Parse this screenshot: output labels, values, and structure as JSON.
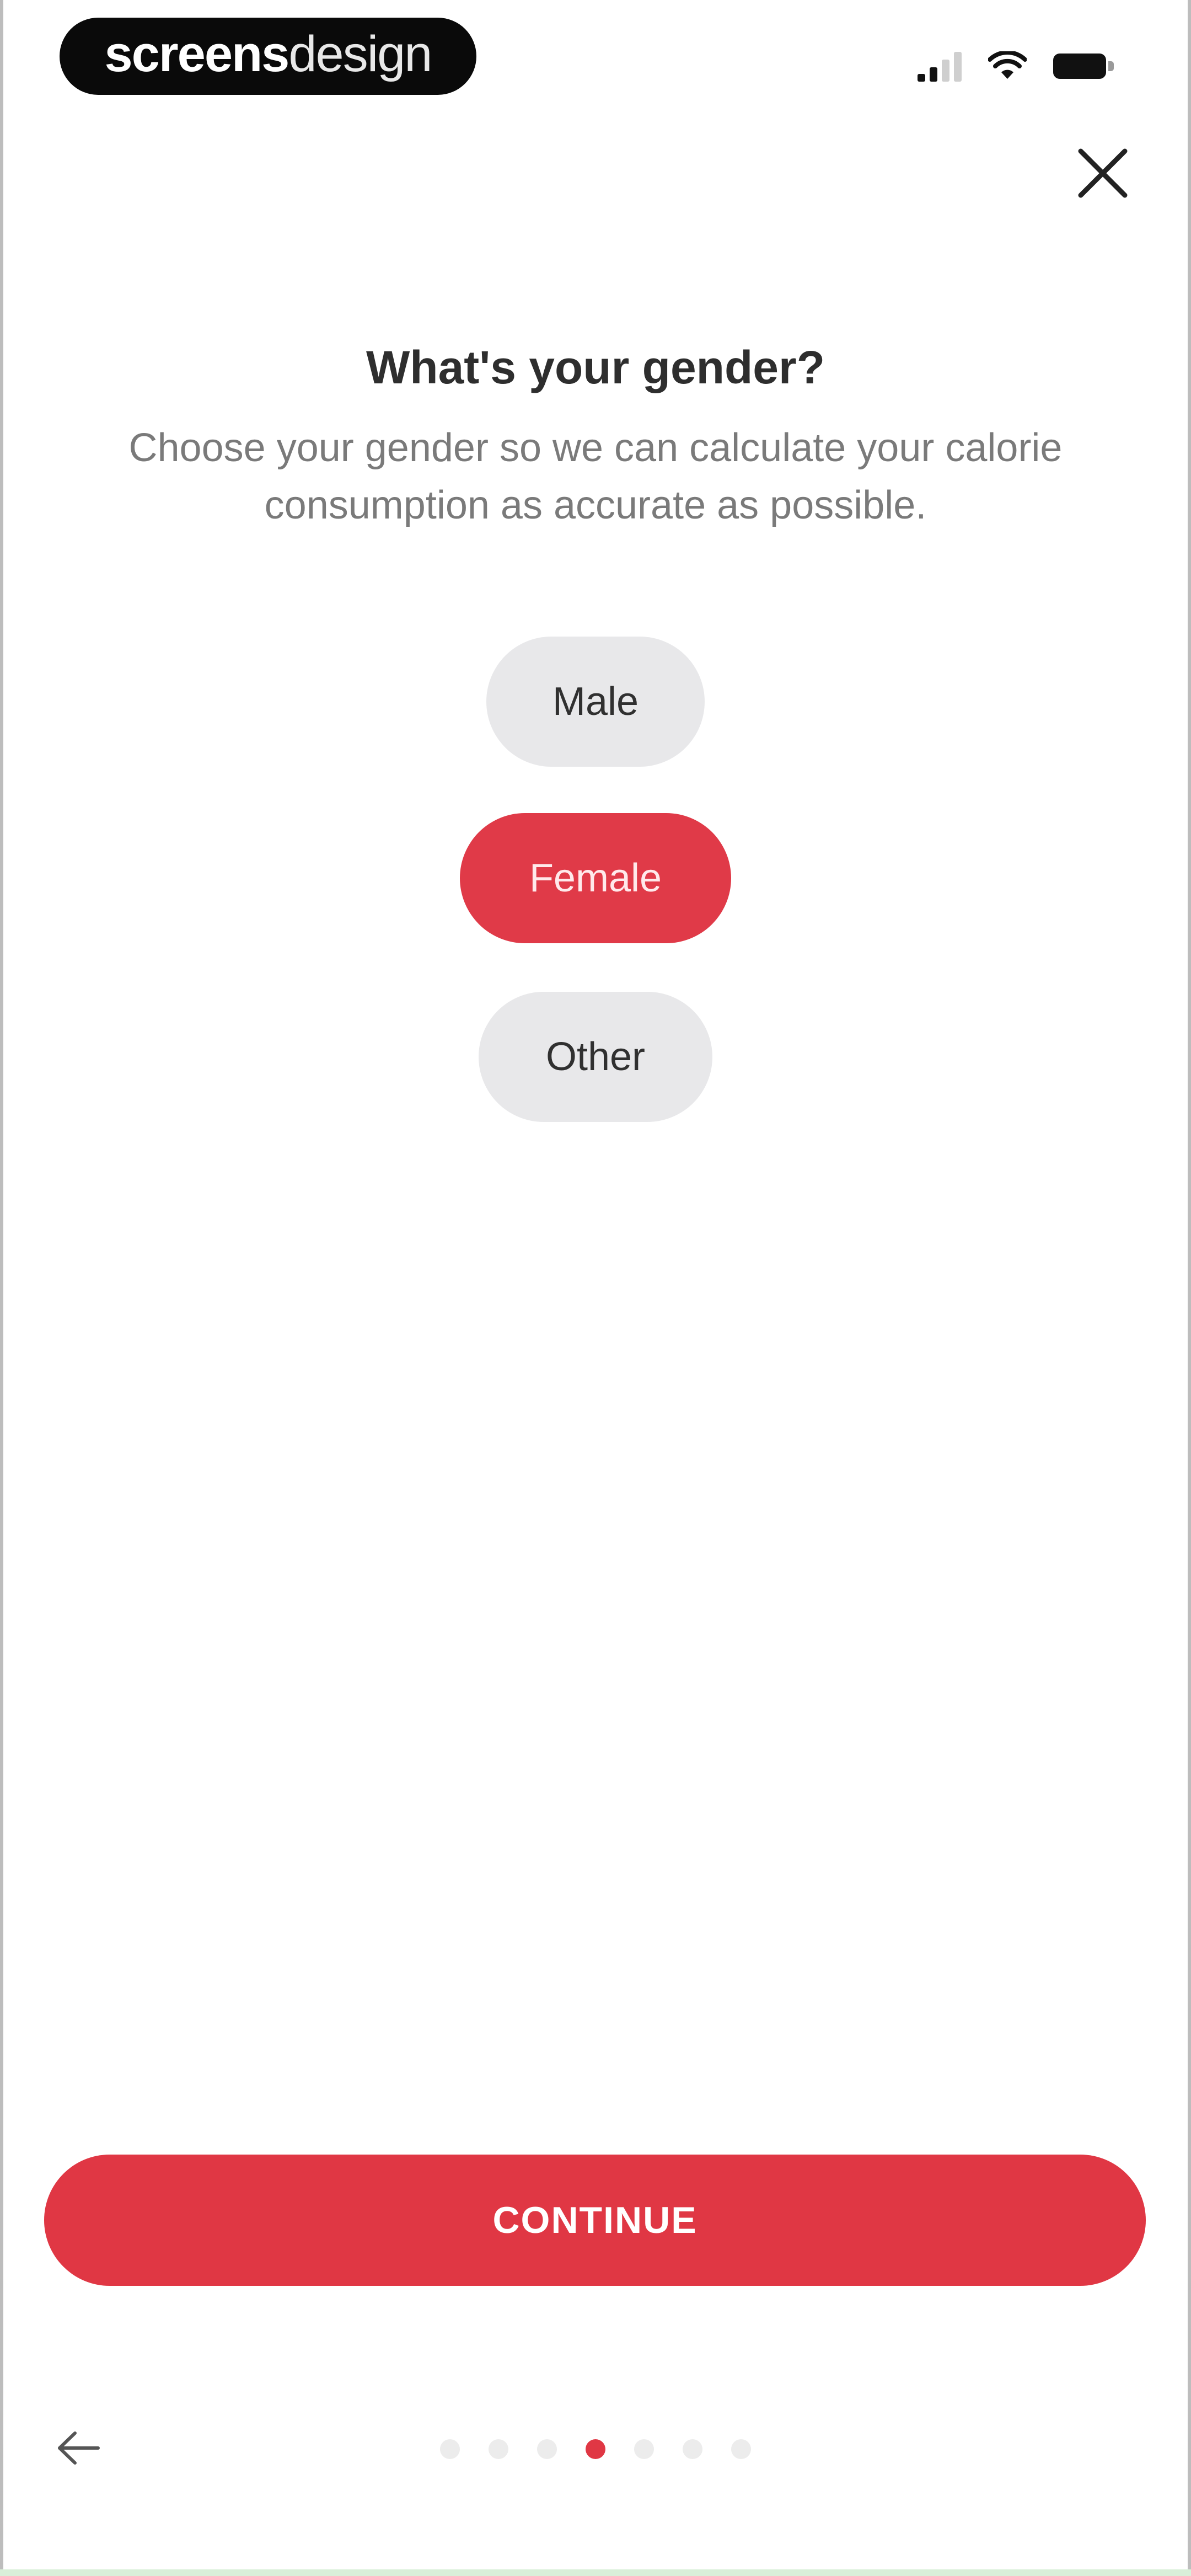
{
  "status_bar": {
    "brand_bold": "screens",
    "brand_light": "design",
    "icons": [
      "signal-icon",
      "wifi-icon",
      "battery-icon"
    ]
  },
  "header": {
    "close_icon": "close-icon",
    "title": "What's your gender?",
    "subtitle": "Choose your gender so we can calculate your calorie consumption as accurate as possible."
  },
  "gender_options": [
    {
      "label": "Male",
      "selected": false
    },
    {
      "label": "Female",
      "selected": true
    },
    {
      "label": "Other",
      "selected": false
    }
  ],
  "continue_button": {
    "label": "CONTINUE"
  },
  "footer": {
    "back_icon": "back-arrow-icon",
    "pager": {
      "total": 7,
      "current": 4
    }
  },
  "colors": {
    "accent": "#e03744",
    "option_bg": "#e8e8ea",
    "title": "#2e2e2e",
    "subtitle": "#7a7a7a"
  }
}
